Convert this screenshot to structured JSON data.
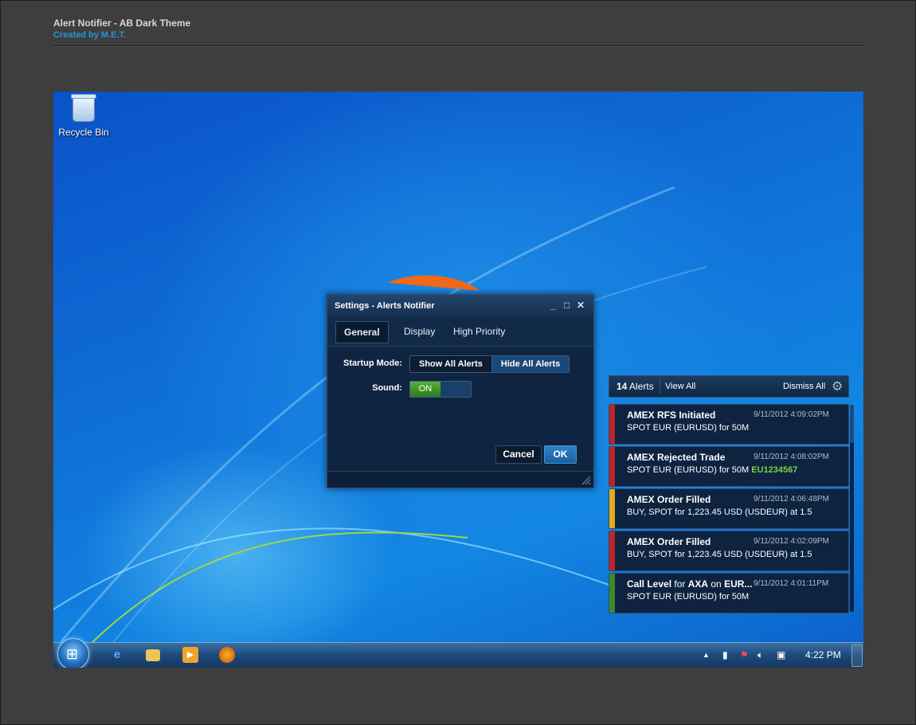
{
  "header": {
    "title": "Alert Notifier - AB Dark Theme",
    "subtitle": "Created by M.E.T."
  },
  "desktop": {
    "recycle_bin_label": "Recycle Bin"
  },
  "settings": {
    "title": "Settings - Alerts Notifier",
    "tabs": [
      "General",
      "Display",
      "High Priority"
    ],
    "active_tab": "General",
    "startup_label": "Startup Mode:",
    "startup_options": [
      "Show All Alerts",
      "Hide All Alerts"
    ],
    "startup_selected": "Show All Alerts",
    "sound_label": "Sound:",
    "sound_value": "ON",
    "cancel_label": "Cancel",
    "ok_label": "OK"
  },
  "alerts": {
    "count": "14",
    "count_label": "Alerts",
    "view_all": "View All",
    "dismiss_all": "Dismiss All",
    "items": [
      {
        "title": "AMEX RFS Initiated",
        "time": "9/11/2012  4:09:02PM",
        "message": "SPOT EUR (EURUSD) for 50M",
        "highlight": "",
        "color": "#c0222a"
      },
      {
        "title": "AMEX Rejected Trade",
        "time": "9/11/2012  4:08:02PM",
        "message": "SPOT EUR (EURUSD) for 50M",
        "highlight": "EU1234567",
        "color": "#c0222a"
      },
      {
        "title": "AMEX Order Filled",
        "time": "9/11/2012  4:06:48PM",
        "message": "BUY, SPOT for 1,223.45 USD (USDEUR) at 1.5",
        "highlight": "",
        "color": "#e1ac1d"
      },
      {
        "title": "AMEX Order Filled",
        "time": "9/11/2012  4:02:09PM",
        "message": "BUY, SPOT for 1,223.45 USD (USDEUR) at 1.5",
        "highlight": "",
        "color": "#c0222a"
      },
      {
        "title_parts": [
          "Call Level",
          " for ",
          "AXA",
          " on ",
          "EUR..."
        ],
        "time": "9/11/2012  4:01:11PM",
        "message": "SPOT EUR (EURUSD) for 50M",
        "highlight": "",
        "color": "#3b8a2a"
      }
    ]
  },
  "taskbar": {
    "clock": "4:22 PM"
  },
  "icons": [
    "recycle-bin-icon",
    "start-orb-icon",
    "ie-icon",
    "explorer-icon",
    "media-player-icon",
    "firefox-icon",
    "gear-icon",
    "minimize-icon",
    "maximize-icon",
    "close-icon",
    "resize-grip-icon"
  ]
}
